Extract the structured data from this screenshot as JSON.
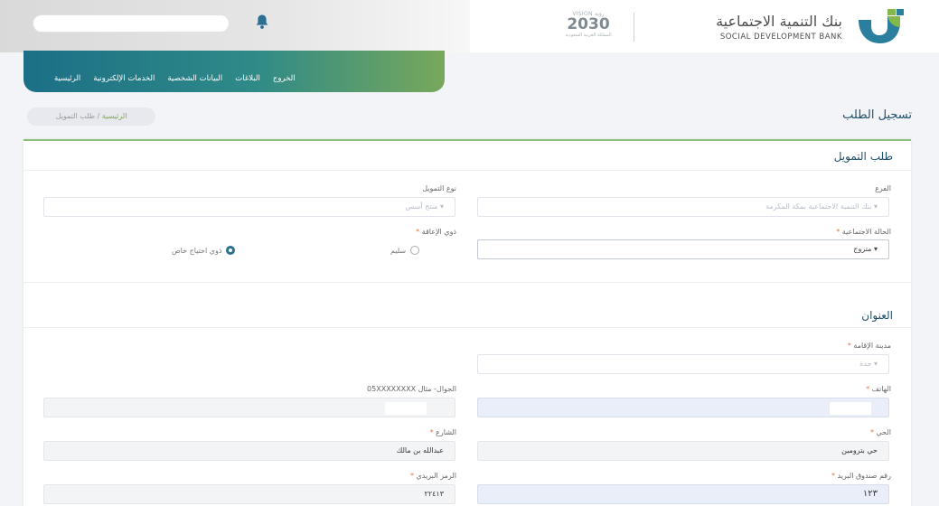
{
  "header": {
    "logo_ar": "بنك التنمية الاجتماعية",
    "logo_en": "SOCIAL DEVELOPMENT BANK",
    "vision_top": "VISION رؤية",
    "vision_year": "2030",
    "vision_bottom": "المملكة العربية السعودية",
    "search_value": "",
    "bell_icon": "bell-icon",
    "logo_icon": "bank-logo-icon"
  },
  "nav": {
    "items": [
      "الرئيسية",
      "الخدمات الإلكترونية",
      "البيانات الشخصية",
      "البلاغات",
      "الخروج"
    ]
  },
  "page": {
    "title": "تسجيل الطلب",
    "breadcrumb_home": "الرئيسية",
    "breadcrumb_sep": " / ",
    "breadcrumb_current": "طلب التمويل"
  },
  "financing": {
    "title": "طلب التمويل",
    "branch_label": "الفرع",
    "branch_value": "بنك التنمية الاجتماعية بمكة المكرمة",
    "type_label": "نوع التمويل",
    "type_value": "منتج أسس",
    "social_label": "الحالة الاجتماعية",
    "social_value": "متزوج",
    "disability_label": "ذوي الإعاقة",
    "radio_healthy": "سليم",
    "radio_special": "ذوي احتياج خاص",
    "required_mark": "*",
    "dropdown_glyph": "▾"
  },
  "address": {
    "title": "العنوان",
    "city_label": "مدينة الإقامة",
    "city_value": "جدة",
    "phone_label": "الهاتف",
    "phone_value": "",
    "mobile_label": "الجوال- مثال 05XXXXXXXX",
    "mobile_value": "",
    "district_label": "الحي",
    "district_value": "حي بترومين",
    "street_label": "الشارع",
    "street_value": "عبدالله بن مالك",
    "pobox_label": "رقم صندوق البريد",
    "pobox_value": "١٢٣",
    "zip_label": "الرمز البريدي",
    "zip_value": "٢٢٤١٣"
  },
  "colors": {
    "accent": "#1f4f6a",
    "nav_start": "#1c6f86",
    "nav_end": "#78a85b",
    "card_top": "#8ec07b",
    "required": "#e07a4a"
  }
}
